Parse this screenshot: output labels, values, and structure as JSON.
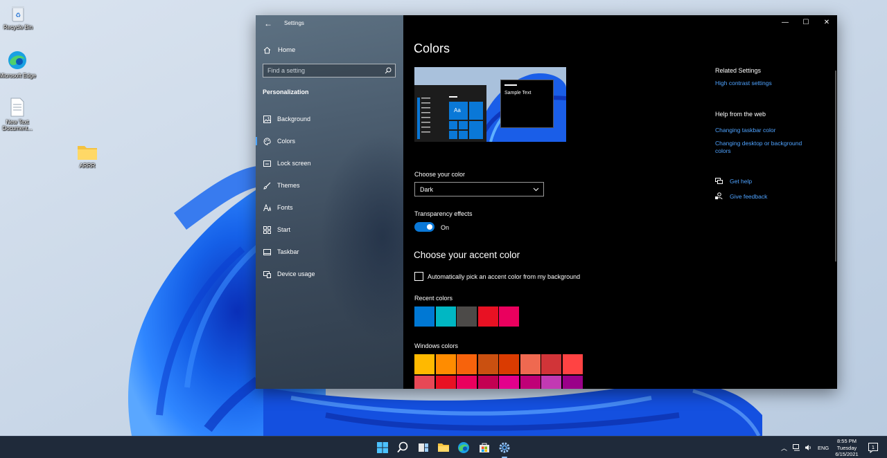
{
  "desktop": {
    "icons": [
      {
        "label": "Recycle Bin"
      },
      {
        "label": "Microsoft Edge"
      },
      {
        "label": "New Text Document..."
      },
      {
        "label": "ARRR"
      }
    ]
  },
  "window": {
    "title": "Settings",
    "caption_buttons": [
      "minimize-icon",
      "maximize-icon",
      "close-icon"
    ]
  },
  "sidebar": {
    "home_label": "Home",
    "search_placeholder": "Find a setting",
    "section_heading": "Personalization",
    "items": [
      {
        "label": "Background",
        "icon": "image-icon"
      },
      {
        "label": "Colors",
        "icon": "palette-icon",
        "active": true
      },
      {
        "label": "Lock screen",
        "icon": "lock-screen-icon"
      },
      {
        "label": "Themes",
        "icon": "brush-icon"
      },
      {
        "label": "Fonts",
        "icon": "font-icon"
      },
      {
        "label": "Start",
        "icon": "start-grid-icon"
      },
      {
        "label": "Taskbar",
        "icon": "taskbar-icon"
      },
      {
        "label": "Device usage",
        "icon": "device-icon"
      }
    ]
  },
  "main": {
    "title": "Colors",
    "preview_sample_text": "Sample Text",
    "preview_tile_text": "Aa",
    "choose_color_label": "Choose your color",
    "choose_color_value": "Dark",
    "transparency_label": "Transparency effects",
    "transparency_state": "On",
    "accent_heading": "Choose your accent color",
    "auto_pick_label": "Automatically pick an accent color from my background",
    "recent_colors_label": "Recent colors",
    "recent_colors": [
      "#0078d4",
      "#00b7c3",
      "#4c4a48",
      "#e81123",
      "#ea005e"
    ],
    "windows_colors_label": "Windows colors",
    "windows_colors_row1": [
      "#ffb900",
      "#ff8c00",
      "#f7630c",
      "#ca5010",
      "#da3b01",
      "#ef6950",
      "#d13438",
      "#ff4343"
    ],
    "windows_colors_row2": [
      "#e74856",
      "#e81123",
      "#ea005e",
      "#c30052",
      "#e3008c",
      "#bf0077",
      "#c239b3",
      "#9a0089"
    ]
  },
  "related": {
    "related_heading": "Related Settings",
    "related_links": [
      "High contrast settings"
    ],
    "help_heading": "Help from the web",
    "help_links": [
      "Changing taskbar color",
      "Changing desktop or background colors"
    ],
    "get_help": "Get help",
    "give_feedback": "Give feedback"
  },
  "taskbar": {
    "icons": [
      "windows-start-icon",
      "search-icon",
      "task-view-icon",
      "file-explorer-icon",
      "edge-icon",
      "store-icon",
      "settings-gear-icon"
    ],
    "language": "ENG",
    "time": "8:55 PM",
    "day": "Tuesday",
    "date": "6/15/2021"
  },
  "colors": {
    "accent": "#0a78d7",
    "link": "#4fa3ff"
  }
}
